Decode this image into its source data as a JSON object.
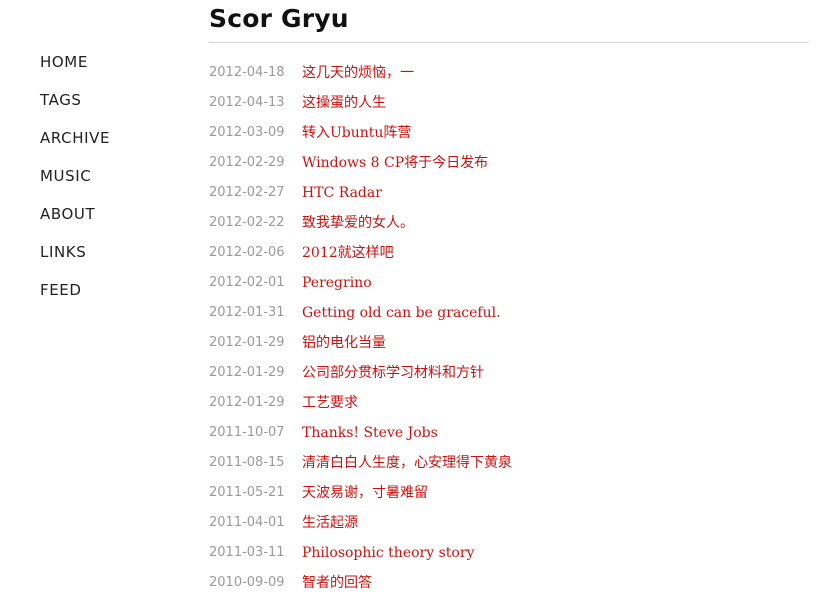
{
  "site": {
    "title": "Scor Gryu"
  },
  "nav": {
    "items": [
      {
        "label": "HOME"
      },
      {
        "label": "TAGS"
      },
      {
        "label": "ARCHIVE"
      },
      {
        "label": "MUSIC"
      },
      {
        "label": "ABOUT"
      },
      {
        "label": "LINKS"
      },
      {
        "label": "FEED"
      }
    ]
  },
  "posts": [
    {
      "date": "2012-04-18",
      "title": "这几天的烦恼，一"
    },
    {
      "date": "2012-04-13",
      "title": "这操蛋的人生"
    },
    {
      "date": "2012-03-09",
      "title": "转入Ubuntu阵营"
    },
    {
      "date": "2012-02-29",
      "title": "Windows 8 CP将于今日发布"
    },
    {
      "date": "2012-02-27",
      "title": "HTC Radar"
    },
    {
      "date": "2012-02-22",
      "title": "致我挚爱的女人。"
    },
    {
      "date": "2012-02-06",
      "title": "2012就这样吧"
    },
    {
      "date": "2012-02-01",
      "title": "Peregrino"
    },
    {
      "date": "2012-01-31",
      "title": "Getting old can be graceful."
    },
    {
      "date": "2012-01-29",
      "title": "铝的电化当量"
    },
    {
      "date": "2012-01-29",
      "title": "公司部分贯标学习材料和方针"
    },
    {
      "date": "2012-01-29",
      "title": "工艺要求"
    },
    {
      "date": "2011-10-07",
      "title": "Thanks! Steve Jobs"
    },
    {
      "date": "2011-08-15",
      "title": "清清白白人生度，心安理得下黄泉"
    },
    {
      "date": "2011-05-21",
      "title": "天波易谢，寸暑难留"
    },
    {
      "date": "2011-04-01",
      "title": "生活起源"
    },
    {
      "date": "2011-03-11",
      "title": "Philosophic theory story"
    },
    {
      "date": "2010-09-09",
      "title": "智者的回答"
    }
  ],
  "colors": {
    "link": "#cc1111",
    "date": "#9a9a9a",
    "nav": "#222222",
    "title": "#111111",
    "rule": "#d4d4d4"
  }
}
